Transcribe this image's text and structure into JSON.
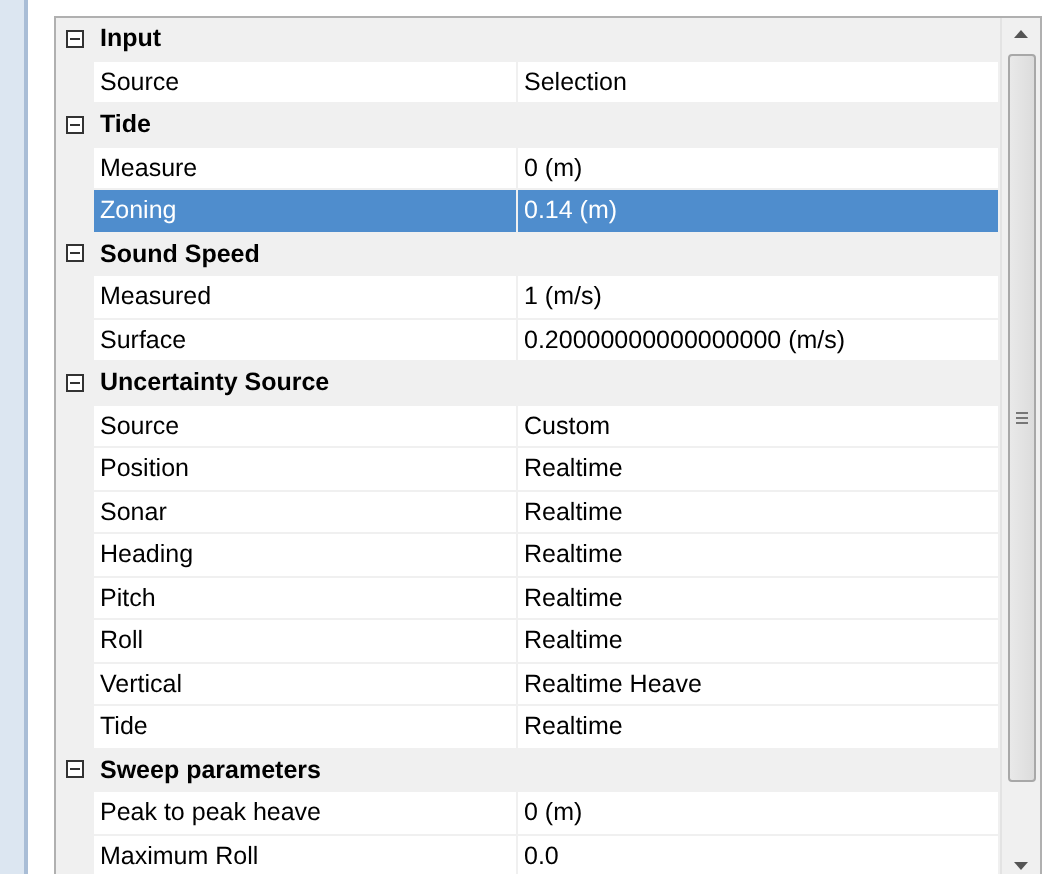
{
  "groups": [
    {
      "label": "Input",
      "expanded": true,
      "rows": [
        {
          "name": "Source",
          "value": "Selection",
          "selected": false
        }
      ]
    },
    {
      "label": "Tide",
      "expanded": true,
      "rows": [
        {
          "name": "Measure",
          "value": "0 (m)",
          "selected": false
        },
        {
          "name": "Zoning",
          "value": "0.14 (m)",
          "selected": true
        }
      ]
    },
    {
      "label": "Sound Speed",
      "expanded": true,
      "rows": [
        {
          "name": "Measured",
          "value": "1 (m/s)",
          "selected": false
        },
        {
          "name": "Surface",
          "value": "0.20000000000000000 (m/s)",
          "selected": false
        }
      ]
    },
    {
      "label": "Uncertainty Source",
      "expanded": true,
      "rows": [
        {
          "name": "Source",
          "value": "Custom",
          "selected": false
        },
        {
          "name": "Position",
          "value": "Realtime",
          "selected": false
        },
        {
          "name": "Sonar",
          "value": "Realtime",
          "selected": false
        },
        {
          "name": "Heading",
          "value": "Realtime",
          "selected": false
        },
        {
          "name": "Pitch",
          "value": "Realtime",
          "selected": false
        },
        {
          "name": "Roll",
          "value": "Realtime",
          "selected": false
        },
        {
          "name": "Vertical",
          "value": "Realtime Heave",
          "selected": false
        },
        {
          "name": "Tide",
          "value": "Realtime",
          "selected": false
        }
      ]
    },
    {
      "label": "Sweep parameters",
      "expanded": true,
      "rows": [
        {
          "name": "Peak to peak heave",
          "value": "0 (m)",
          "selected": false
        },
        {
          "name": "Maximum Roll",
          "value": "0.0",
          "selected": false
        }
      ]
    }
  ]
}
